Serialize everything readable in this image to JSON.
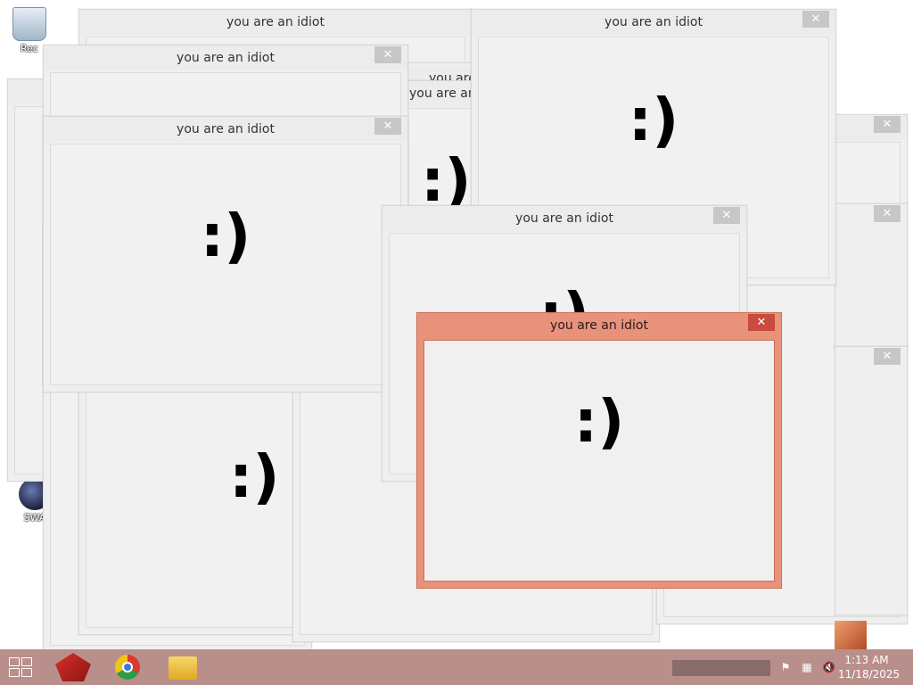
{
  "popup": {
    "title": "you are an idiot",
    "face": ":)",
    "close_glyph": "✕"
  },
  "desktop": {
    "icons": [
      {
        "label": "Rec"
      },
      {
        "label": "SWA"
      }
    ]
  },
  "clock": {
    "time": "1:13 AM",
    "date": "11/18/2025"
  }
}
